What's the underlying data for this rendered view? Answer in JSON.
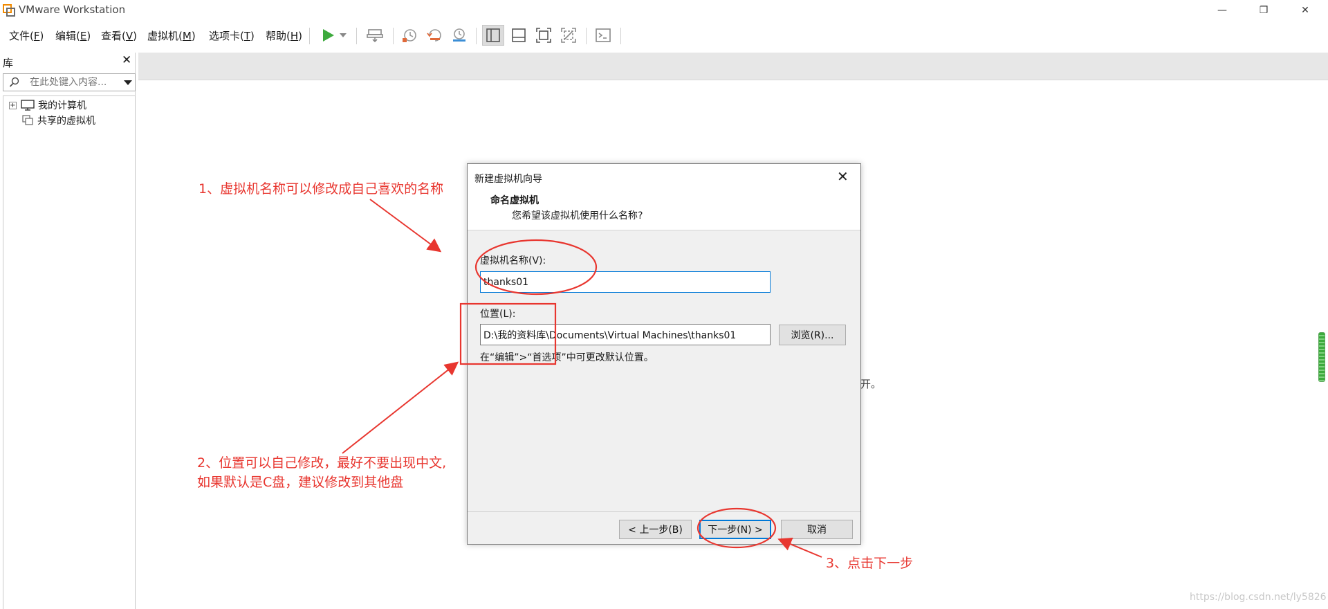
{
  "window": {
    "title": "VMware Workstation",
    "minimize_glyph": "—",
    "restore_glyph": "❐",
    "close_glyph": "✕"
  },
  "menu": [
    {
      "label": "文件(",
      "key": "F",
      "suffix": ")"
    },
    {
      "label": "编辑(",
      "key": "E",
      "suffix": ")"
    },
    {
      "label": "查看(",
      "key": "V",
      "suffix": ")"
    },
    {
      "label": "虚拟机(",
      "key": "M",
      "suffix": ")"
    },
    {
      "label": "选项卡(",
      "key": "T",
      "suffix": ")"
    },
    {
      "label": "帮助(",
      "key": "H",
      "suffix": ")"
    }
  ],
  "toolbar_icons": [
    "play-icon",
    "dropdown-arrow-icon",
    "send-keys-icon",
    "snapshot-icon",
    "revert-snapshot-icon",
    "snapshot-manager-icon",
    "sidebar-view-icon",
    "console-view-icon",
    "fullscreen-icon",
    "unity-icon",
    "terminal-icon"
  ],
  "library": {
    "title": "库",
    "close_glyph": "✕",
    "search_placeholder": "在此处键入内容...",
    "tree": [
      {
        "label": "我的计算机",
        "expander": "+",
        "icon": "computer-icon"
      },
      {
        "label": "共享的虚拟机",
        "icon": "shared-vm-icon"
      }
    ]
  },
  "background_text": "开。",
  "watermark": "https://blog.csdn.net/ly5826",
  "dialog": {
    "title": "新建虚拟机向导",
    "close_glyph": "✕",
    "heading": "命名虚拟机",
    "subheading": "您希望该虚拟机使用什么名称?",
    "vm_name_label": "虚拟机名称(V):",
    "vm_name_value": "thanks01",
    "location_label": "位置(L):",
    "location_value": "D:\\我的资料库\\Documents\\Virtual Machines\\thanks01",
    "browse_button": "浏览(R)...",
    "hint": "在“编辑”>“首选项”中可更改默认位置。",
    "back_button": "< 上一步(B)",
    "next_button": "下一步(N) >",
    "cancel_button": "取消"
  },
  "annotations": {
    "note1": "1、虚拟机名称可以修改成自己喜欢的名称",
    "note2_line1": "2、位置可以自己修改，最好不要出现中文,",
    "note2_line2": "如果默认是C盘，建议修改到其他盘",
    "note3": "3、点击下一步",
    "color": "#e8362f"
  }
}
